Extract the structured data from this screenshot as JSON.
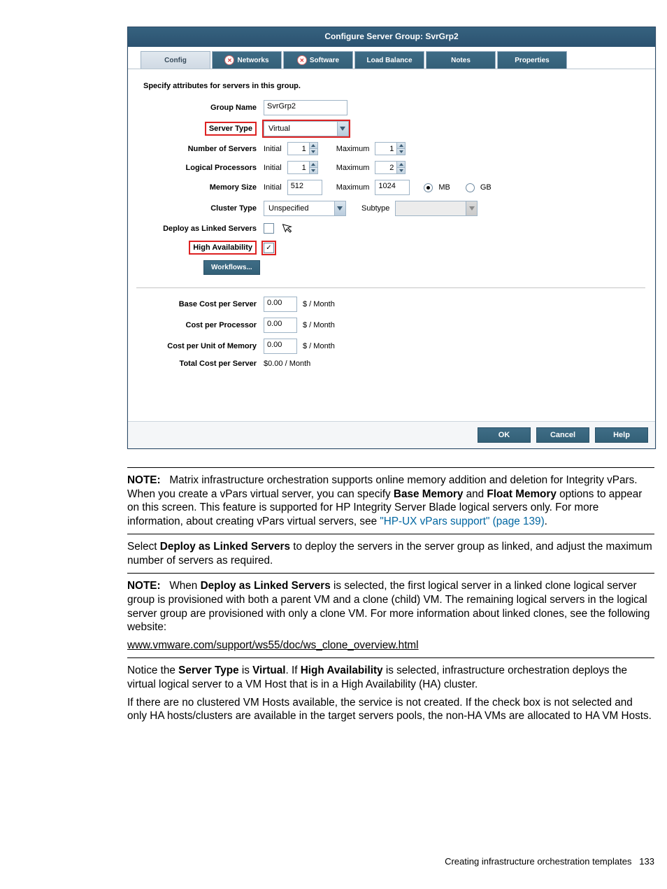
{
  "dialog": {
    "title": "Configure Server Group: SvrGrp2",
    "tabs": {
      "config": "Config",
      "networks": "Networks",
      "software": "Software",
      "loadbalance": "Load Balance",
      "notes": "Notes",
      "properties": "Properties"
    },
    "caption": "Specify attributes for servers in this group.",
    "labels": {
      "group_name": "Group Name",
      "server_type": "Server Type",
      "num_servers": "Number of Servers",
      "logical_procs": "Logical Processors",
      "memory_size": "Memory Size",
      "cluster_type": "Cluster Type",
      "deploy_linked": "Deploy as Linked Servers",
      "high_avail": "High Availability",
      "workflows": "Workflows...",
      "base_cost": "Base Cost per Server",
      "cost_proc": "Cost per Processor",
      "cost_mem": "Cost per Unit of Memory",
      "total_cost": "Total Cost per Server",
      "initial": "Initial",
      "maximum": "Maximum",
      "subtype": "Subtype",
      "mb": "MB",
      "gb": "GB",
      "per_month": "$ / Month"
    },
    "values": {
      "group_name": "SvrGrp2",
      "server_type": "Virtual",
      "servers_initial": "1",
      "servers_max": "1",
      "procs_initial": "1",
      "procs_max": "2",
      "mem_initial": "512",
      "mem_max": "1024",
      "cluster_type": "Unspecified",
      "cluster_subtype": "",
      "base_cost": "0.00",
      "cost_proc": "0.00",
      "cost_mem": "0.00",
      "total_cost": "$0.00 / Month"
    },
    "buttons": {
      "ok": "OK",
      "cancel": "Cancel",
      "help": "Help"
    }
  },
  "doc": {
    "note1_label": "NOTE:",
    "note1_a": "Matrix infrastructure orchestration supports online memory addition and deletion for Integrity vPars. When you create a vPars virtual server, you can specify ",
    "note1_b": "Base Memory",
    "note1_c": " and ",
    "note1_d": "Float Memory",
    "note1_e": " options to appear on this screen. This feature is supported for HP Integrity Server Blade logical servers only. For more information, about creating vPars virtual servers, see ",
    "note1_link": "\"HP-UX vPars support\" (page 139)",
    "note1_f": ".",
    "p1_a": "Select ",
    "p1_b": "Deploy as Linked Servers",
    "p1_c": " to deploy the servers in the server group as linked, and adjust the maximum number of servers as required.",
    "note2_label": "NOTE:",
    "note2_a": "When ",
    "note2_b": "Deploy as Linked Servers",
    "note2_c": " is selected, the first logical server in a linked clone logical server group is provisioned with both a parent VM and a clone (child) VM. The remaining logical servers in the logical server group are provisioned with only a clone VM. For more information about linked clones, see the following website:",
    "note2_url": "www.vmware.com/support/ws55/doc/ws_clone_overview.html",
    "p2_a": "Notice the ",
    "p2_b": "Server Type",
    "p2_c": " is ",
    "p2_d": "Virtual",
    "p2_e": ". If ",
    "p2_f": "High Availability",
    "p2_g": " is selected, infrastructure orchestration deploys the virtual logical server to a VM Host that is in a High Availability (HA) cluster.",
    "p3": "If there are no clustered VM Hosts available, the service is not created. If the check box is not selected and only HA hosts/clusters are available in the target servers pools, the non-HA VMs are allocated to HA VM Hosts.",
    "footer": "Creating infrastructure orchestration templates",
    "page": "133"
  }
}
